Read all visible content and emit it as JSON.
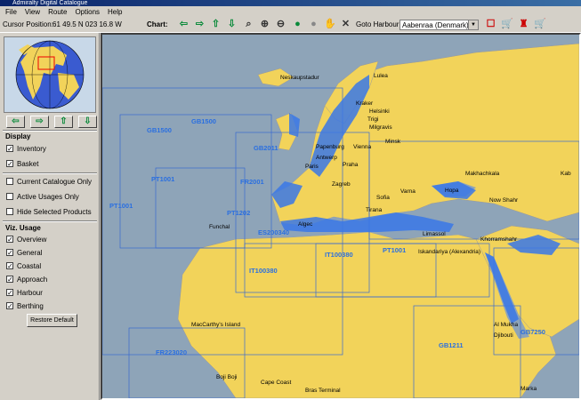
{
  "window": {
    "title": "Admiralty Digital Catalogue"
  },
  "menu": [
    "File",
    "View",
    "Route",
    "Options",
    "Help"
  ],
  "toolbar": {
    "cursor_label": "Cursor Position:",
    "cursor_value": "61 49.5 N   023 16.8 W",
    "chart_label": "Chart:",
    "goto_label": "Goto Harbour:",
    "goto_value": "Aabenraa (Denmark)",
    "icons": [
      "arrow-left-icon",
      "arrow-right-icon",
      "arrow-up-icon",
      "arrow-down-icon",
      "zoom-icon",
      "zoom-in-icon",
      "zoom-out-icon",
      "go-icon",
      "stop-icon",
      "hand-icon",
      "crosshair-icon",
      "cart-icon",
      "cart-icon",
      "bag-icon",
      "cart-icon"
    ]
  },
  "panel": {
    "display_header": "Display",
    "display_items": [
      {
        "label": "Inventory",
        "checked": true
      },
      {
        "label": "Basket",
        "checked": true
      }
    ],
    "filter_items": [
      {
        "label": "Current Catalogue Only",
        "checked": false
      },
      {
        "label": "Active Usages Only",
        "checked": false
      },
      {
        "label": "Hide Selected Products",
        "checked": false
      }
    ],
    "usage_header": "Viz. Usage",
    "usage_items": [
      {
        "label": "Overview",
        "checked": true
      },
      {
        "label": "General",
        "checked": true
      },
      {
        "label": "Coastal",
        "checked": true
      },
      {
        "label": "Approach",
        "checked": true
      },
      {
        "label": "Harbour",
        "checked": true
      },
      {
        "label": "Berthing",
        "checked": true
      }
    ],
    "restore_label": "Restore Default"
  },
  "map": {
    "colors": {
      "sea": "#8ea4b8",
      "land": "#f2d35a",
      "coverage": "#3a78e8",
      "chart_label": "#2a6fe0"
    },
    "place_names": [
      "Neskaupstadur",
      "Lulea",
      "Helsinki",
      "Kraker",
      "Trigi",
      "Milgravis",
      "Minsk",
      "Papenburg",
      "Antwerp",
      "Paris",
      "Praha",
      "Vienna",
      "Zagreb",
      "Sofia",
      "Varna",
      "Makhachkala",
      "Kab",
      "Hopa",
      "Now Shahr",
      "Funchal",
      "Algec",
      "Tirana",
      "Limassol",
      "Iskandariya (Alexandria)",
      "Khorramshahr",
      "MacCarthy's Island",
      "Al Mukha",
      "Djibouti",
      "Boji Boji",
      "Cape Coast",
      "Bras Terminal",
      "Marka"
    ],
    "chart_labels": [
      "GB1500",
      "GB1500",
      "PT1001",
      "PT1001",
      "GB2011",
      "FR2001",
      "PT1202",
      "ES200340",
      "IT100380",
      "IT100380",
      "FR223020",
      "GB1211",
      "PT1001",
      "GB7250"
    ]
  }
}
